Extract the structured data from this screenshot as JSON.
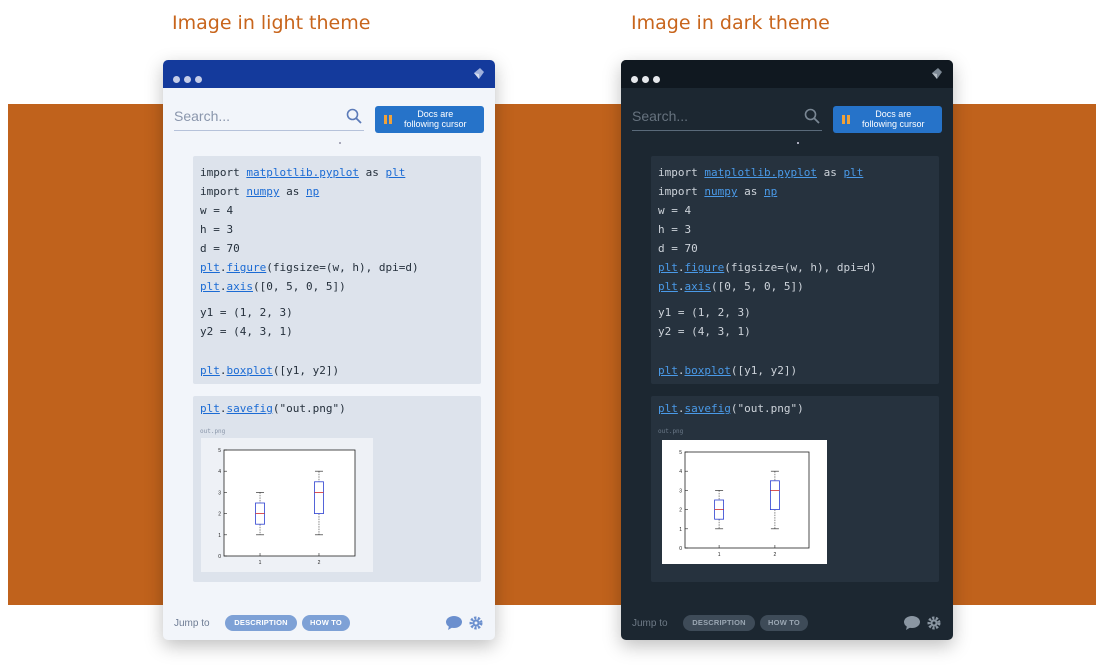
{
  "captions": {
    "light": "Image in light theme",
    "dark": "Image in dark theme"
  },
  "colors": {
    "accent_orange": "#c0621c",
    "light_titlebar": "#143a9c",
    "dark_bg": "#1c2731",
    "docs_button": "#2673c9"
  },
  "panel": {
    "search_placeholder": "Search...",
    "docs_button": {
      "line1": "Docs are",
      "line2": "following cursor"
    },
    "code_block_1": {
      "lines": [
        {
          "plain_a": "import ",
          "link": "matplotlib.pyplot",
          "plain_b": " as ",
          "link2": "plt"
        },
        {
          "plain_a": "import ",
          "link": "numpy",
          "plain_b": " as ",
          "link2": "np"
        },
        {
          "text": "w = 4"
        },
        {
          "text": "h = 3"
        },
        {
          "text": "d = 70"
        },
        {
          "link": "plt",
          "dot": ".",
          "link2": "figure",
          "rest": "(figsize=(w, h), dpi=d)"
        },
        {
          "link": "plt",
          "dot": ".",
          "link2": "axis",
          "rest": "([0, 5, 0, 5])"
        },
        {
          "text": "y1 = (1, 2, 3)"
        },
        {
          "text": "y2 = (4, 3, 1)"
        },
        {
          "link": "plt",
          "dot": ".",
          "link2": "boxplot",
          "rest": "([y1, y2])"
        }
      ]
    },
    "code_block_2": {
      "line": {
        "link": "plt",
        "dot": ".",
        "link2": "savefig",
        "rest": "(\"out.png\")"
      },
      "output_filename": "out.png"
    },
    "footer": {
      "jump_to": "Jump to",
      "description": "DESCRIPTION",
      "how_to": "HOW TO"
    },
    "icons": [
      "search-icon",
      "pause-icon",
      "chat-icon",
      "gear-icon",
      "kite-logo-icon"
    ]
  },
  "chart_data": {
    "type": "boxplot",
    "categories": [
      "1",
      "2"
    ],
    "y_ticks": [
      "0",
      "1",
      "2",
      "3",
      "4",
      "5"
    ],
    "ylim": [
      0,
      5
    ],
    "series": [
      {
        "category": "1",
        "min": 1,
        "q1": 1.5,
        "median": 2,
        "q3": 2.5,
        "max": 3
      },
      {
        "category": "2",
        "min": 1,
        "q1": 2,
        "median": 3,
        "q3": 3.5,
        "max": 4
      }
    ]
  }
}
